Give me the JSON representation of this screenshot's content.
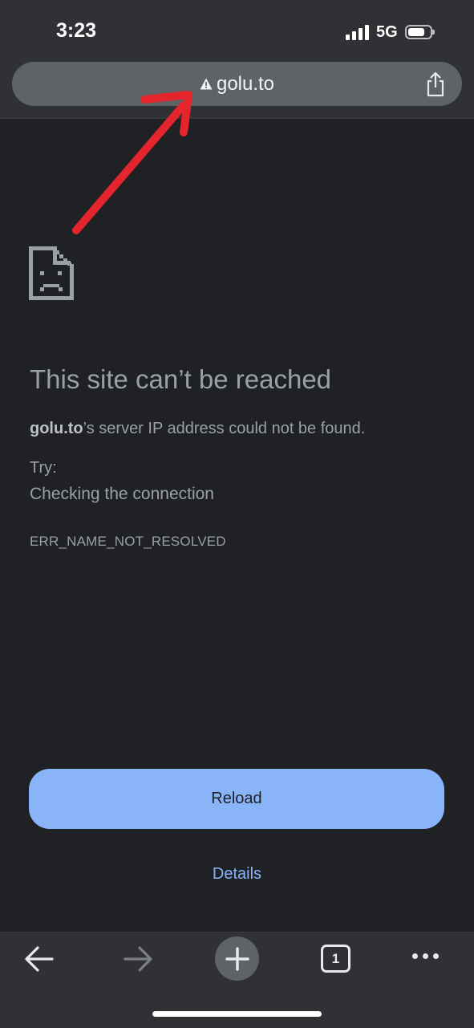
{
  "status": {
    "time": "3:23",
    "network": "5G",
    "battery_level": 0.75
  },
  "browser": {
    "url": "golu.to",
    "url_icon": "warning-triangle-icon",
    "share_icon": "share-icon"
  },
  "error": {
    "title": "This site can’t be reached",
    "host": "golu.to",
    "message_suffix": "’s server IP address could not be found.",
    "try_label": "Try:",
    "suggestion": "Checking the connection",
    "code": "ERR_NAME_NOT_RESOLVED"
  },
  "actions": {
    "reload_label": "Reload",
    "details_label": "Details"
  },
  "toolbar": {
    "tab_count": "1"
  },
  "colors": {
    "accent": "#8ab4f8",
    "annotation_arrow": "#e4252c",
    "background": "#202124"
  }
}
